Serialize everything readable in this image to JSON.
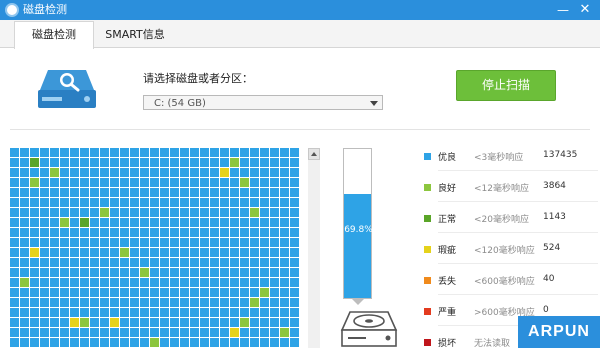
{
  "window": {
    "title": "磁盘检测",
    "min_symbol": "—",
    "close_symbol": "✕"
  },
  "tabs": [
    {
      "label": "磁盘检测",
      "active": true
    },
    {
      "label": "SMART信息",
      "active": false
    }
  ],
  "selector": {
    "label": "请选择磁盘或者分区：",
    "value": "C:  (54 GB)"
  },
  "scan_button": {
    "label": "停止扫描"
  },
  "progress": {
    "percent_text": "69.8%",
    "value": 0.698
  },
  "legend": [
    {
      "name": "优良",
      "range": "<3毫秒响应",
      "count": "137435",
      "color": "#2ea3e6"
    },
    {
      "name": "良好",
      "range": "<12毫秒响应",
      "count": "3864",
      "color": "#8cc63e"
    },
    {
      "name": "正常",
      "range": "<20毫秒响应",
      "count": "1143",
      "color": "#5aa528"
    },
    {
      "name": "瑕疵",
      "range": "<120毫秒响应",
      "count": "524",
      "color": "#e5d21b"
    },
    {
      "name": "丢失",
      "range": "<600毫秒响应",
      "count": "40",
      "color": "#f08a1c"
    },
    {
      "name": "严重",
      "range": ">600毫秒响应",
      "count": "0",
      "color": "#e33b1f"
    },
    {
      "name": "损坏",
      "range": "无法读取",
      "count": "",
      "color": "#c0161b"
    }
  ],
  "colors": {
    "accent": "#2b8fdc",
    "cell_good": "#2ea3e6",
    "cell_fine": "#8cc63e",
    "cell_normal": "#5aa528",
    "cell_flaw": "#e5d21b",
    "scan_button": "#6dbf3a"
  },
  "icons": {
    "hdd": "hard-disk-magnifier-icon",
    "drive": "hard-drive-icon"
  },
  "watermark": {
    "text": "ARPUN"
  }
}
